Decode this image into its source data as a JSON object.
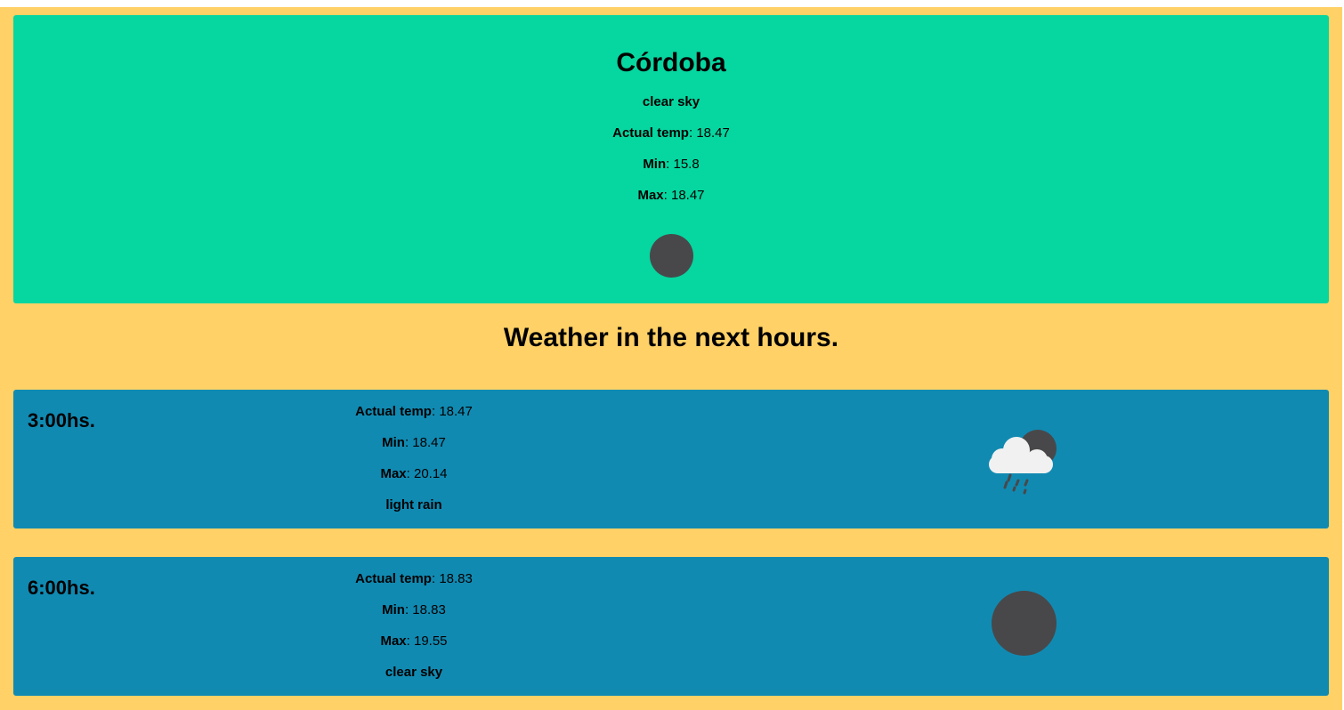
{
  "current": {
    "city": "Córdoba",
    "description": "clear sky",
    "actual_label": "Actual temp",
    "actual_value": ": 18.47",
    "min_label": "Min",
    "min_value": ": 15.8",
    "max_label": "Max",
    "max_value": ": 18.47",
    "icon": "moon-icon"
  },
  "forecast_title": "Weather in the next hours.",
  "forecast": [
    {
      "hour": "3:00hs.",
      "actual_label": "Actual temp",
      "actual_value": ": 18.47",
      "min_label": "Min",
      "min_value": ": 18.47",
      "max_label": "Max",
      "max_value": ": 20.14",
      "description": "light rain",
      "icon": "rain-cloud-moon-icon"
    },
    {
      "hour": "6:00hs.",
      "actual_label": "Actual temp",
      "actual_value": ": 18.83",
      "min_label": "Min",
      "min_value": ": 18.83",
      "max_label": "Max",
      "max_value": ": 19.55",
      "description": "clear sky",
      "icon": "moon-icon"
    }
  ],
  "colors": {
    "page_background": "#ffd166",
    "current_card": "#06d6a0",
    "forecast_card": "#118ab2",
    "moon": "#48484a"
  }
}
